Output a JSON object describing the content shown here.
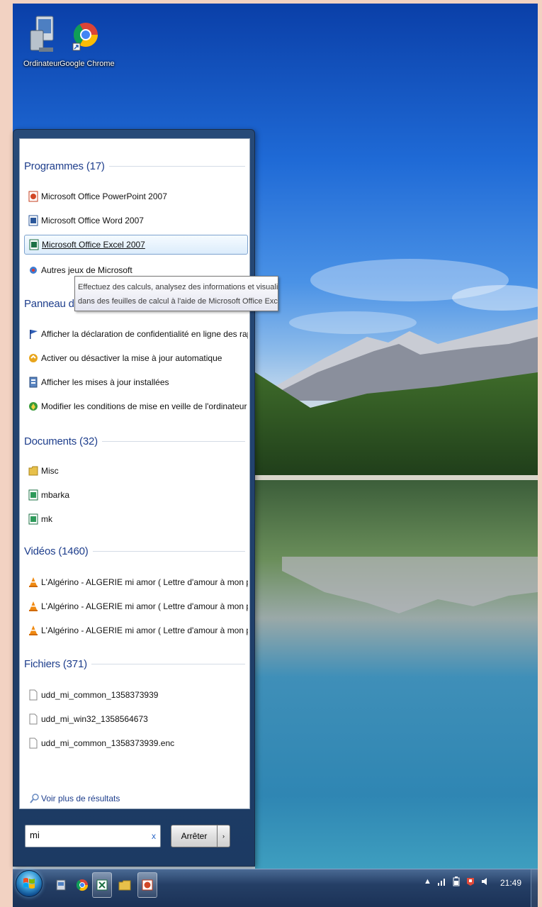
{
  "desktop": {
    "icons": [
      {
        "label": "Ordinateur",
        "icon": "computer-icon"
      },
      {
        "label": "Google Chrome",
        "icon": "chrome-icon"
      }
    ]
  },
  "start_menu": {
    "groups": {
      "programs": {
        "header": "Programmes (17)",
        "items": [
          {
            "label": "Microsoft Office PowerPoint 2007",
            "icon": "powerpoint-icon"
          },
          {
            "label": "Microsoft Office Word 2007",
            "icon": "word-icon"
          },
          {
            "label": "Microsoft Office Excel 2007",
            "icon": "excel-icon",
            "selected": true
          },
          {
            "label": "Autres jeux de Microsoft",
            "icon": "games-icon"
          }
        ]
      },
      "control_panel": {
        "header": "Panneau de con",
        "items": [
          {
            "label": "Afficher la déclaration de confidentialité en ligne des rapports d'erreurs Mic...",
            "icon": "flag-icon"
          },
          {
            "label": "Activer ou désactiver la mise à jour automatique",
            "icon": "windows-update-icon"
          },
          {
            "label": "Afficher les mises à jour installées",
            "icon": "installed-updates-icon"
          },
          {
            "label": "Modifier les conditions de mise en veille de l'ordinateur",
            "icon": "power-options-icon"
          }
        ]
      },
      "documents": {
        "header": "Documents (32)",
        "items": [
          {
            "label": "Misc",
            "icon": "folder-icon"
          },
          {
            "label": "mbarka",
            "icon": "excel-file-icon"
          },
          {
            "label": "mk",
            "icon": "excel-file-icon"
          }
        ]
      },
      "videos": {
        "header": "Vidéos (1460)",
        "items": [
          {
            "label": "L'Algérino - ALGERIE mi amor ( Lettre d'amour à mon pays )",
            "icon": "vlc-icon"
          },
          {
            "label": "L'Algérino - ALGERIE mi amor ( Lettre d'amour à mon pays )",
            "icon": "vlc-icon"
          },
          {
            "label": "L'Algérino - ALGERIE mi amor ( Lettre d'amour à mon pays )",
            "icon": "vlc-icon"
          }
        ]
      },
      "files": {
        "header": "Fichiers (371)",
        "items": [
          {
            "label": "udd_mi_common_1358373939",
            "icon": "file-icon"
          },
          {
            "label": "udd_mi_win32_1358564673",
            "icon": "file-icon"
          },
          {
            "label": "udd_mi_common_1358373939.enc",
            "icon": "file-icon"
          }
        ]
      }
    },
    "tooltip": {
      "line1": "Effectuez des calculs, analysez des informations et visualisez des données",
      "line2": "dans des feuilles de calcul à l'aide de Microsoft Office Excel."
    },
    "more_results": "Voir plus de résultats",
    "search": {
      "value": "mi",
      "clear": "x"
    },
    "stop_button": "Arrêter",
    "stop_arrow": "›"
  },
  "taskbar": {
    "clock": "21:49",
    "pinned": [
      "explorer-icon",
      "chrome-icon",
      "excel-icon",
      "folder-icon",
      "powerpoint-icon"
    ]
  },
  "colors": {
    "group_header": "#1e3e8c",
    "frame": "#f2d2c2"
  }
}
